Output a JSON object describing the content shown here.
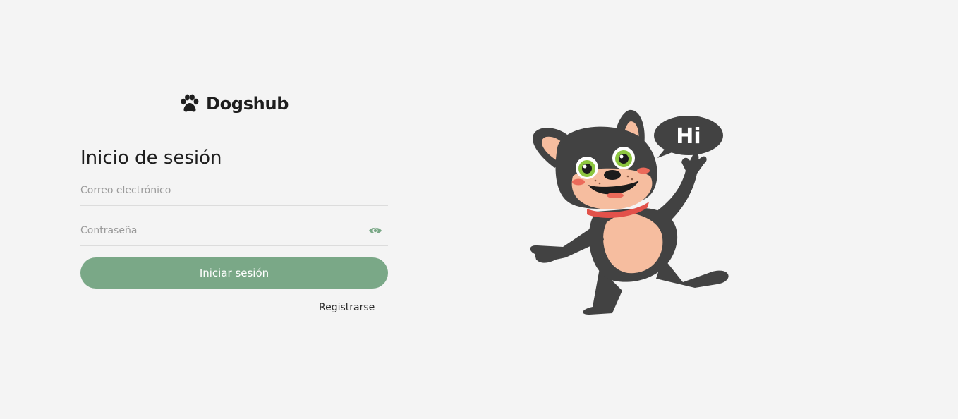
{
  "brand": {
    "name": "Dogshub",
    "icon": "paw-icon"
  },
  "login": {
    "title": "Inicio de sesión",
    "email": {
      "placeholder": "Correo electrónico",
      "value": ""
    },
    "password": {
      "placeholder": "Contraseña",
      "value": "",
      "toggle_icon": "eye-icon"
    },
    "submit_label": "Iniciar sesión",
    "register_label": "Registrarse"
  },
  "illustration": {
    "speech_bubble_text": "Hi"
  },
  "colors": {
    "background": "#f4f4f4",
    "accent": "#7aa887",
    "text": "#1e1e1e"
  }
}
